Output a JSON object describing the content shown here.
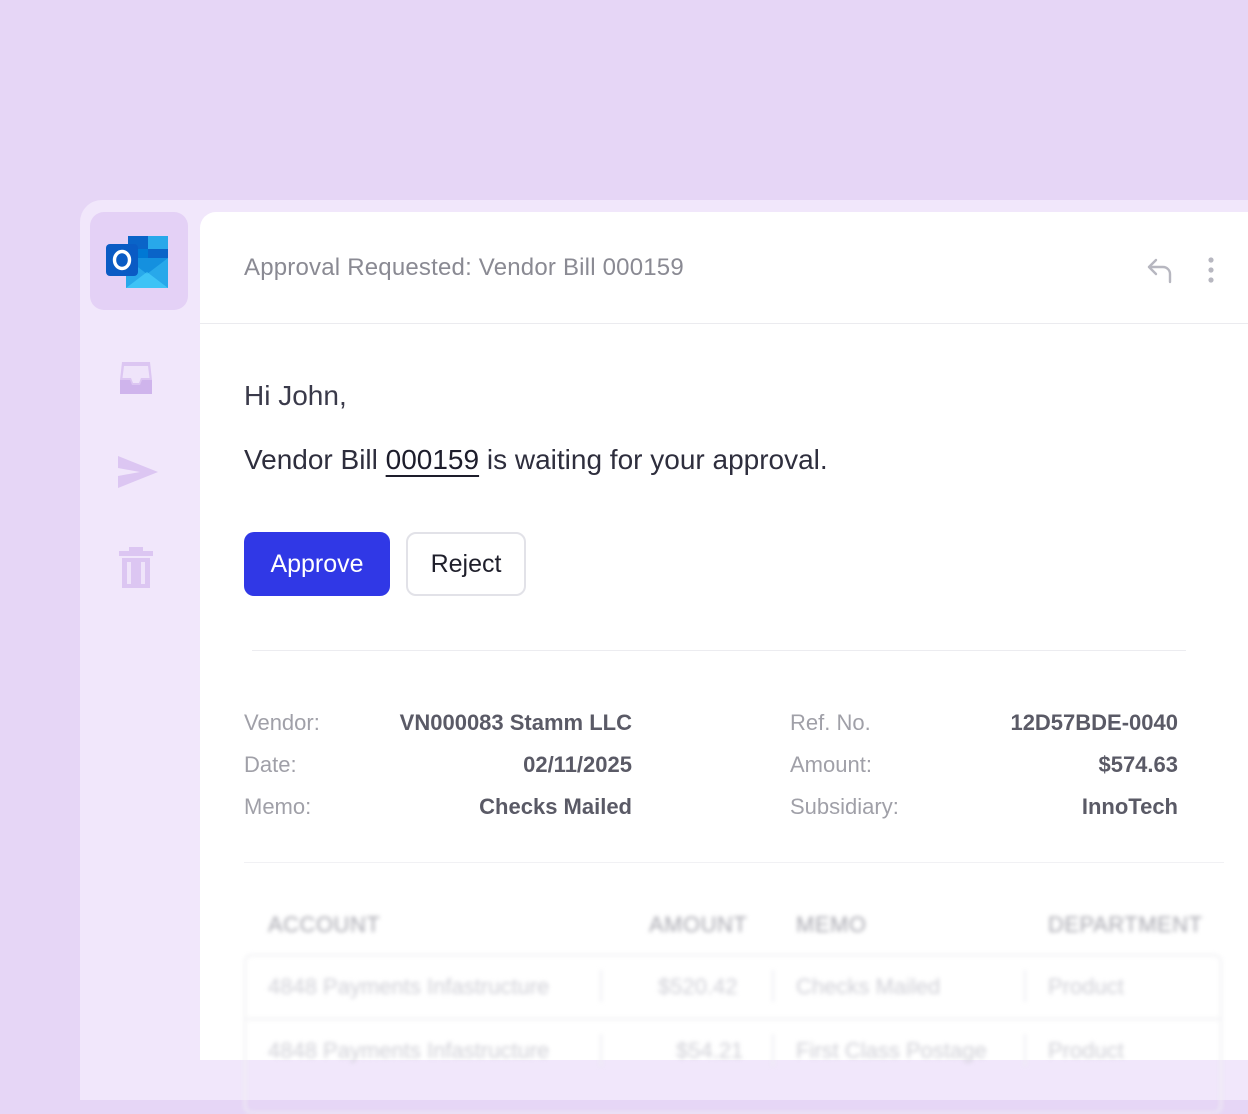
{
  "app": {
    "name": "Outlook"
  },
  "nav": {
    "items": [
      {
        "name": "Inbox",
        "icon": "inbox-icon"
      },
      {
        "name": "Sent",
        "icon": "send-icon"
      },
      {
        "name": "Trash",
        "icon": "trash-icon"
      }
    ]
  },
  "email": {
    "subject": "Approval Requested: Vendor Bill 000159",
    "greeting": "Hi John,",
    "message_prefix": "Vendor Bill ",
    "bill_link": "000159",
    "message_suffix": " is waiting for your approval.",
    "approve_label": "Approve",
    "reject_label": "Reject"
  },
  "details": {
    "left": [
      {
        "label": "Vendor:",
        "value": "VN000083 Stamm LLC"
      },
      {
        "label": "Date:",
        "value": "02/11/2025"
      },
      {
        "label": "Memo:",
        "value": "Checks Mailed"
      }
    ],
    "right": [
      {
        "label": "Ref. No.",
        "value": "12D57BDE-0040"
      },
      {
        "label": "Amount:",
        "value": "$574.63"
      },
      {
        "label": "Subsidiary:",
        "value": "InnoTech"
      }
    ]
  },
  "lines": {
    "headers": [
      "ACCOUNT",
      "AMOUNT",
      "MEMO",
      "DEPARTMENT"
    ],
    "rows": [
      [
        "4848 Payments Infastructure",
        "$520.42",
        "Checks Mailed",
        "Product"
      ],
      [
        "4848 Payments Infastructure",
        "$54.21",
        "First Class Postage",
        "Product"
      ]
    ]
  },
  "colors": {
    "background": "#e6d6f6",
    "accent": "#3038e6",
    "outlook_blue": "#0a64c8"
  }
}
